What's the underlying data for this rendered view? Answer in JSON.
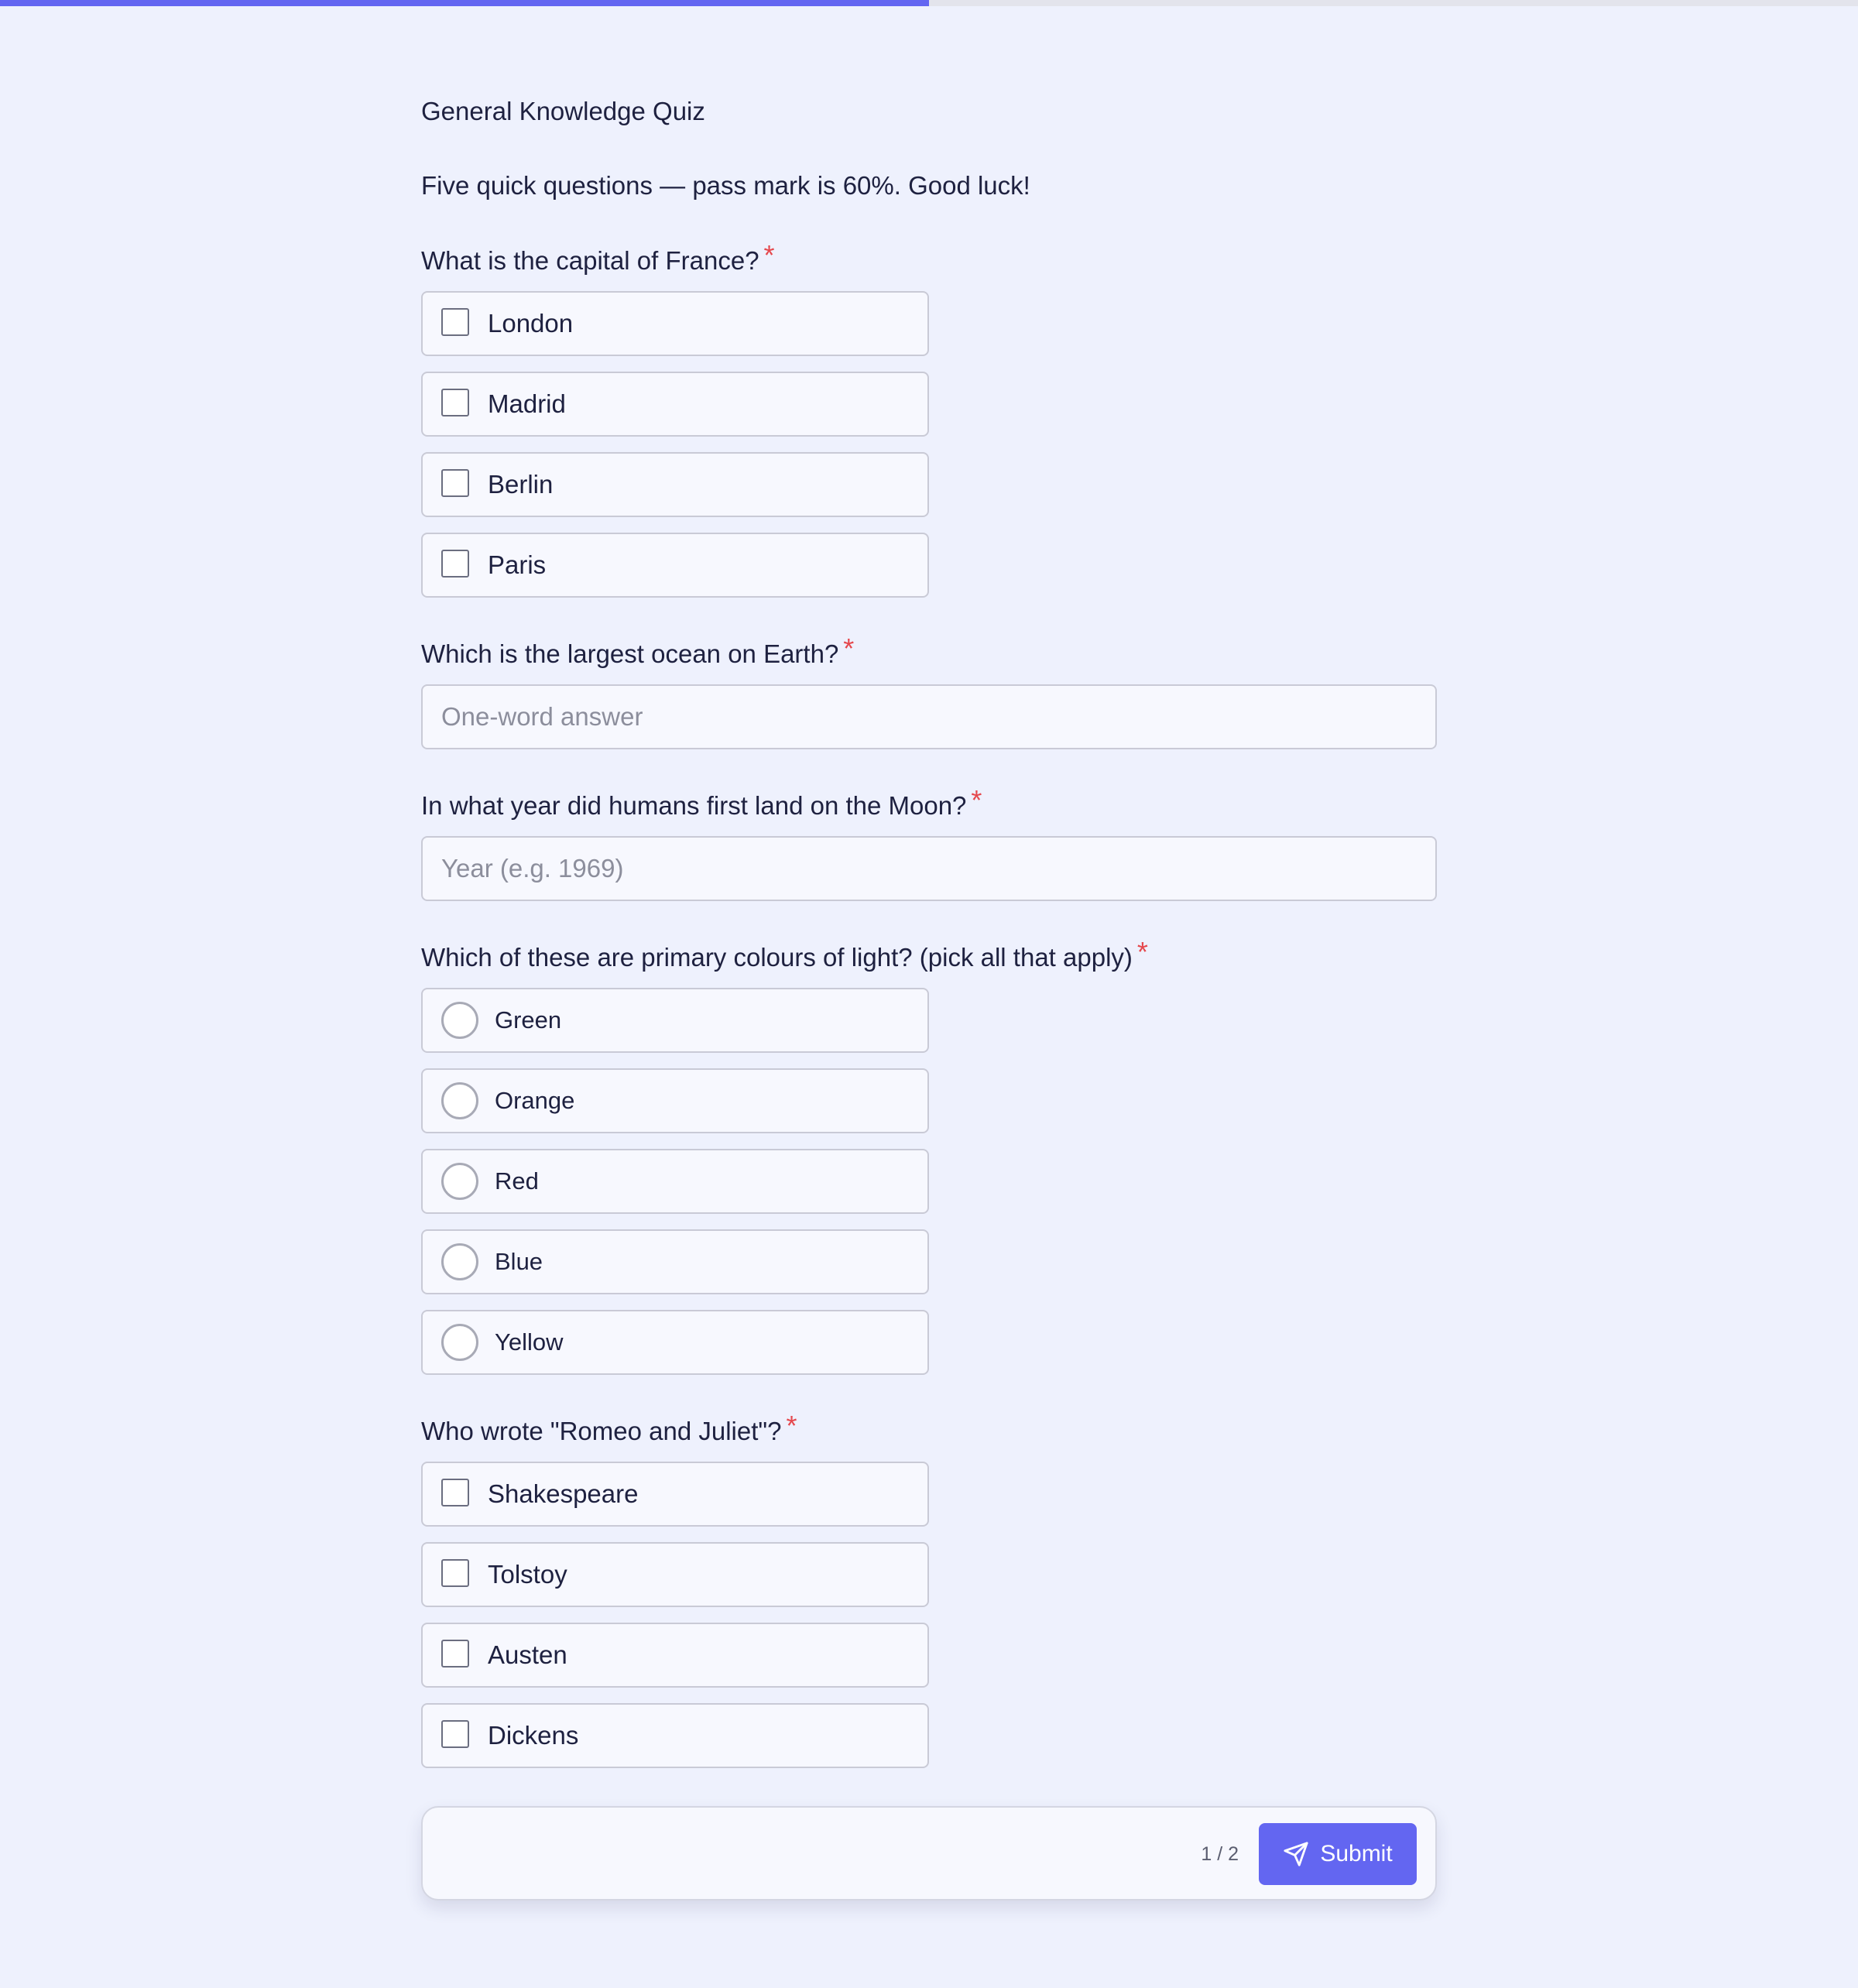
{
  "progress": {
    "fraction": 0.5
  },
  "quiz": {
    "title": "General Knowledge Quiz",
    "description": "Five quick questions — pass mark is 60%. Good luck!"
  },
  "required_marker": "*",
  "questions": [
    {
      "label": "What is the capital of France?",
      "options": [
        "London",
        "Madrid",
        "Berlin",
        "Paris"
      ]
    },
    {
      "label": "Which is the largest ocean on Earth?",
      "placeholder": "One-word answer"
    },
    {
      "label": "In what year did humans first land on the Moon?",
      "placeholder": "Year (e.g. 1969)"
    },
    {
      "label": "Which of these are primary colours of light? (pick all that apply)",
      "options": [
        "Green",
        "Orange",
        "Red",
        "Blue",
        "Yellow"
      ]
    },
    {
      "label": "Who wrote \"Romeo and Juliet\"?",
      "options": [
        "Shakespeare",
        "Tolstoy",
        "Austen",
        "Dickens"
      ]
    }
  ],
  "footer": {
    "page_indicator": "1 / 2",
    "submit_label": "Submit",
    "submit_icon": "send-icon"
  },
  "colors": {
    "accent": "#6366f1",
    "required": "#e5484d",
    "background": "#eef1fd"
  }
}
